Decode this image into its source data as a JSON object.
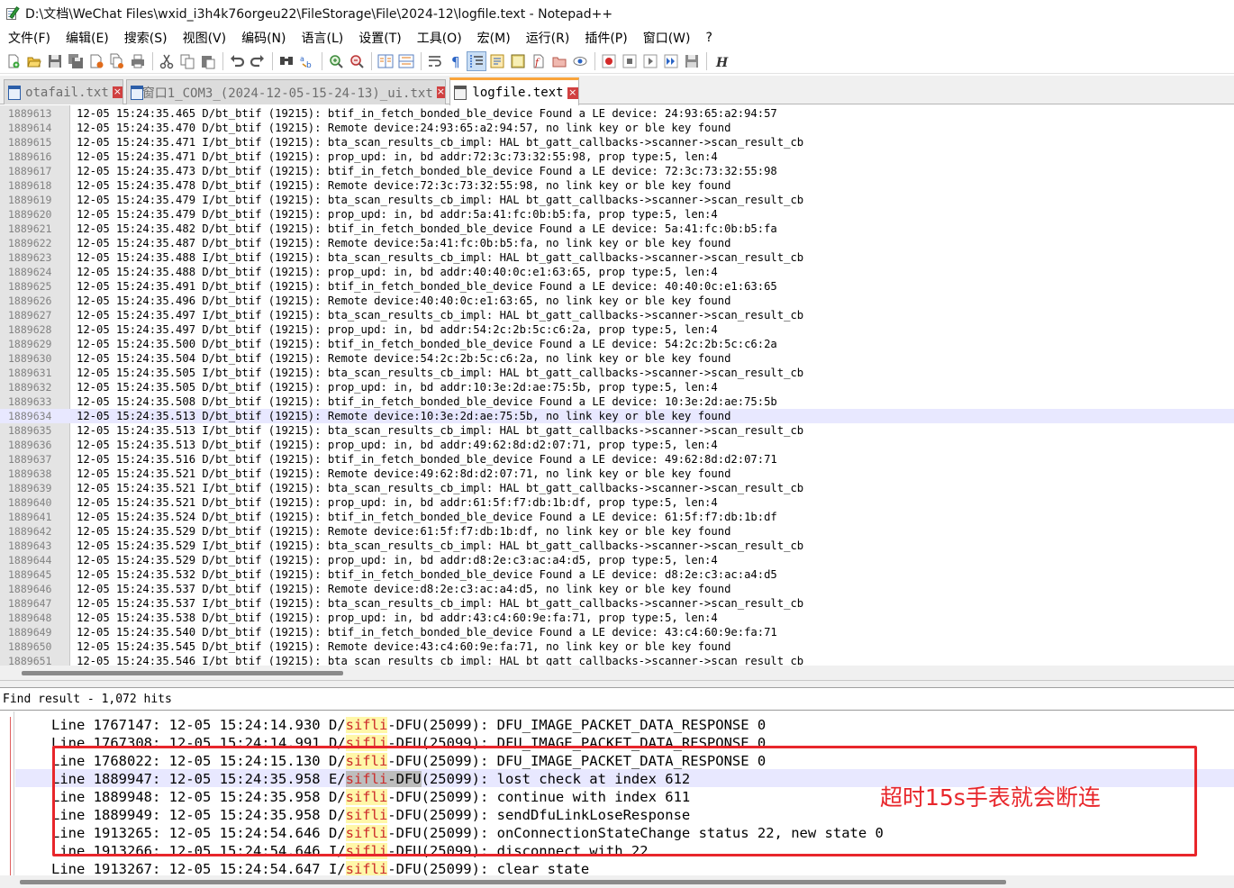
{
  "window": {
    "title": "D:\\文档\\WeChat Files\\wxid_i3h4k76orgeu22\\FileStorage\\File\\2024-12\\logfile.text - Notepad++"
  },
  "menu": [
    "文件(F)",
    "编辑(E)",
    "搜索(S)",
    "视图(V)",
    "编码(N)",
    "语言(L)",
    "设置(T)",
    "工具(O)",
    "宏(M)",
    "运行(R)",
    "插件(P)",
    "窗口(W)",
    "?"
  ],
  "toolbar": {
    "icons": [
      "new-file-icon",
      "open-file-icon",
      "save-icon",
      "save-all-icon",
      "close-icon",
      "close-all-icon",
      "print-icon",
      "cut-icon",
      "copy-icon",
      "paste-icon",
      "undo-icon",
      "redo-icon",
      "find-icon",
      "replace-icon",
      "zoom-in-icon",
      "zoom-out-icon",
      "sync-vertical-icon",
      "sync-horizontal-icon",
      "word-wrap-icon",
      "show-all-chars-icon",
      "indent-guide-icon",
      "doc-map-icon",
      "function-list-icon",
      "folder-workspace-icon",
      "doc-monitor-icon",
      "macro-record-icon",
      "macro-stop-icon",
      "macro-play-icon",
      "macro-run-multiple-icon",
      "macro-save-icon",
      "italic-h-icon"
    ]
  },
  "tabs": [
    {
      "label": "otafail.txt",
      "active": false
    },
    {
      "label": "窗口1_COM3_(2024-12-05-15-24-13)_ui.txt",
      "active": false
    },
    {
      "label": "logfile.text",
      "active": true
    }
  ],
  "editor": {
    "current_line": "1889634",
    "lines": [
      {
        "n": "1889613",
        "t": "12-05 15:24:35.465 D/bt_btif (19215): btif_in_fetch_bonded_ble_device Found a LE device: 24:93:65:a2:94:57"
      },
      {
        "n": "1889614",
        "t": "12-05 15:24:35.470 D/bt_btif (19215): Remote device:24:93:65:a2:94:57, no link key or ble key found"
      },
      {
        "n": "1889615",
        "t": "12-05 15:24:35.471 I/bt_btif (19215): bta_scan_results_cb_impl: HAL bt_gatt_callbacks->scanner->scan_result_cb"
      },
      {
        "n": "1889616",
        "t": "12-05 15:24:35.471 D/bt_btif (19215): prop_upd: in, bd addr:72:3c:73:32:55:98, prop type:5, len:4"
      },
      {
        "n": "1889617",
        "t": "12-05 15:24:35.473 D/bt_btif (19215): btif_in_fetch_bonded_ble_device Found a LE device: 72:3c:73:32:55:98"
      },
      {
        "n": "1889618",
        "t": "12-05 15:24:35.478 D/bt_btif (19215): Remote device:72:3c:73:32:55:98, no link key or ble key found"
      },
      {
        "n": "1889619",
        "t": "12-05 15:24:35.479 I/bt_btif (19215): bta_scan_results_cb_impl: HAL bt_gatt_callbacks->scanner->scan_result_cb"
      },
      {
        "n": "1889620",
        "t": "12-05 15:24:35.479 D/bt_btif (19215): prop_upd: in, bd addr:5a:41:fc:0b:b5:fa, prop type:5, len:4"
      },
      {
        "n": "1889621",
        "t": "12-05 15:24:35.482 D/bt_btif (19215): btif_in_fetch_bonded_ble_device Found a LE device: 5a:41:fc:0b:b5:fa"
      },
      {
        "n": "1889622",
        "t": "12-05 15:24:35.487 D/bt_btif (19215): Remote device:5a:41:fc:0b:b5:fa, no link key or ble key found"
      },
      {
        "n": "1889623",
        "t": "12-05 15:24:35.488 I/bt_btif (19215): bta_scan_results_cb_impl: HAL bt_gatt_callbacks->scanner->scan_result_cb"
      },
      {
        "n": "1889624",
        "t": "12-05 15:24:35.488 D/bt_btif (19215): prop_upd: in, bd addr:40:40:0c:e1:63:65, prop type:5, len:4"
      },
      {
        "n": "1889625",
        "t": "12-05 15:24:35.491 D/bt_btif (19215): btif_in_fetch_bonded_ble_device Found a LE device: 40:40:0c:e1:63:65"
      },
      {
        "n": "1889626",
        "t": "12-05 15:24:35.496 D/bt_btif (19215): Remote device:40:40:0c:e1:63:65, no link key or ble key found"
      },
      {
        "n": "1889627",
        "t": "12-05 15:24:35.497 I/bt_btif (19215): bta_scan_results_cb_impl: HAL bt_gatt_callbacks->scanner->scan_result_cb"
      },
      {
        "n": "1889628",
        "t": "12-05 15:24:35.497 D/bt_btif (19215): prop_upd: in, bd addr:54:2c:2b:5c:c6:2a, prop type:5, len:4"
      },
      {
        "n": "1889629",
        "t": "12-05 15:24:35.500 D/bt_btif (19215): btif_in_fetch_bonded_ble_device Found a LE device: 54:2c:2b:5c:c6:2a"
      },
      {
        "n": "1889630",
        "t": "12-05 15:24:35.504 D/bt_btif (19215): Remote device:54:2c:2b:5c:c6:2a, no link key or ble key found"
      },
      {
        "n": "1889631",
        "t": "12-05 15:24:35.505 I/bt_btif (19215): bta_scan_results_cb_impl: HAL bt_gatt_callbacks->scanner->scan_result_cb"
      },
      {
        "n": "1889632",
        "t": "12-05 15:24:35.505 D/bt_btif (19215): prop_upd: in, bd addr:10:3e:2d:ae:75:5b, prop type:5, len:4"
      },
      {
        "n": "1889633",
        "t": "12-05 15:24:35.508 D/bt_btif (19215): btif_in_fetch_bonded_ble_device Found a LE device: 10:3e:2d:ae:75:5b"
      },
      {
        "n": "1889634",
        "t": "12-05 15:24:35.513 D/bt_btif (19215): Remote device:10:3e:2d:ae:75:5b, no link key or ble key found"
      },
      {
        "n": "1889635",
        "t": "12-05 15:24:35.513 I/bt_btif (19215): bta_scan_results_cb_impl: HAL bt_gatt_callbacks->scanner->scan_result_cb"
      },
      {
        "n": "1889636",
        "t": "12-05 15:24:35.513 D/bt_btif (19215): prop_upd: in, bd addr:49:62:8d:d2:07:71, prop type:5, len:4"
      },
      {
        "n": "1889637",
        "t": "12-05 15:24:35.516 D/bt_btif (19215): btif_in_fetch_bonded_ble_device Found a LE device: 49:62:8d:d2:07:71"
      },
      {
        "n": "1889638",
        "t": "12-05 15:24:35.521 D/bt_btif (19215): Remote device:49:62:8d:d2:07:71, no link key or ble key found"
      },
      {
        "n": "1889639",
        "t": "12-05 15:24:35.521 I/bt_btif (19215): bta_scan_results_cb_impl: HAL bt_gatt_callbacks->scanner->scan_result_cb"
      },
      {
        "n": "1889640",
        "t": "12-05 15:24:35.521 D/bt_btif (19215): prop_upd: in, bd addr:61:5f:f7:db:1b:df, prop type:5, len:4"
      },
      {
        "n": "1889641",
        "t": "12-05 15:24:35.524 D/bt_btif (19215): btif_in_fetch_bonded_ble_device Found a LE device: 61:5f:f7:db:1b:df"
      },
      {
        "n": "1889642",
        "t": "12-05 15:24:35.529 D/bt_btif (19215): Remote device:61:5f:f7:db:1b:df, no link key or ble key found"
      },
      {
        "n": "1889643",
        "t": "12-05 15:24:35.529 I/bt_btif (19215): bta_scan_results_cb_impl: HAL bt_gatt_callbacks->scanner->scan_result_cb"
      },
      {
        "n": "1889644",
        "t": "12-05 15:24:35.529 D/bt_btif (19215): prop_upd: in, bd addr:d8:2e:c3:ac:a4:d5, prop type:5, len:4"
      },
      {
        "n": "1889645",
        "t": "12-05 15:24:35.532 D/bt_btif (19215): btif_in_fetch_bonded_ble_device Found a LE device: d8:2e:c3:ac:a4:d5"
      },
      {
        "n": "1889646",
        "t": "12-05 15:24:35.537 D/bt_btif (19215): Remote device:d8:2e:c3:ac:a4:d5, no link key or ble key found"
      },
      {
        "n": "1889647",
        "t": "12-05 15:24:35.537 I/bt_btif (19215): bta_scan_results_cb_impl: HAL bt_gatt_callbacks->scanner->scan_result_cb"
      },
      {
        "n": "1889648",
        "t": "12-05 15:24:35.538 D/bt_btif (19215): prop_upd: in, bd addr:43:c4:60:9e:fa:71, prop type:5, len:4"
      },
      {
        "n": "1889649",
        "t": "12-05 15:24:35.540 D/bt_btif (19215): btif_in_fetch_bonded_ble_device Found a LE device: 43:c4:60:9e:fa:71"
      },
      {
        "n": "1889650",
        "t": "12-05 15:24:35.545 D/bt_btif (19215): Remote device:43:c4:60:9e:fa:71, no link key or ble key found"
      },
      {
        "n": "1889651",
        "t": "12-05 15:24:35.546 I/bt_btif (19215): bta_scan_results_cb_impl: HAL bt_gatt_callbacks->scanner->scan_result_cb"
      }
    ]
  },
  "find_results": {
    "title": "Find result - 1,072 hits",
    "keyword": "sifli",
    "current_row": 3,
    "rows": [
      {
        "pre": "Line 1767147: 12-05 15:24:14.930 D/",
        "kw": "sifli",
        "dfu": "-DFU",
        "post": "(25099): DFU_IMAGE_PACKET_DATA_RESPONSE 0"
      },
      {
        "pre": "Line 1767308: 12-05 15:24:14.991 D/",
        "kw": "sifli",
        "dfu": "-DFU",
        "post": "(25099): DFU_IMAGE_PACKET_DATA_RESPONSE 0"
      },
      {
        "pre": "Line 1768022: 12-05 15:24:15.130 D/",
        "kw": "sifli",
        "dfu": "-DFU",
        "post": "(25099): DFU_IMAGE_PACKET_DATA_RESPONSE 0"
      },
      {
        "pre": "Line 1889947: 12-05 15:24:35.958 E/",
        "kw": "sifli",
        "dfu": "-DFU",
        "post": "(25099): lost check at index 612"
      },
      {
        "pre": "Line 1889948: 12-05 15:24:35.958 D/",
        "kw": "sifli",
        "dfu": "-DFU",
        "post": "(25099): continue with index 611"
      },
      {
        "pre": "Line 1889949: 12-05 15:24:35.958 D/",
        "kw": "sifli",
        "dfu": "-DFU",
        "post": "(25099): sendDfuLinkLoseResponse"
      },
      {
        "pre": "Line 1913265: 12-05 15:24:54.646 D/",
        "kw": "sifli",
        "dfu": "-DFU",
        "post": "(25099): onConnectionStateChange status 22, new state 0"
      },
      {
        "pre": "Line 1913266: 12-05 15:24:54.646 I/",
        "kw": "sifli",
        "dfu": "-DFU",
        "post": "(25099): disconnect with 22"
      },
      {
        "pre": "Line 1913267: 12-05 15:24:54.647 I/",
        "kw": "sifli",
        "dfu": "-DFU",
        "post": "(25099): clear state"
      }
    ]
  },
  "annotation": {
    "text": "超时15s手表就会断连",
    "color": "#e8262b"
  },
  "colors": {
    "accent_tab": "#f9a43b",
    "current_line": "#e8e8ff",
    "keyword_bg": "#fff7a8",
    "keyword_fg": "#cc2a2a"
  }
}
